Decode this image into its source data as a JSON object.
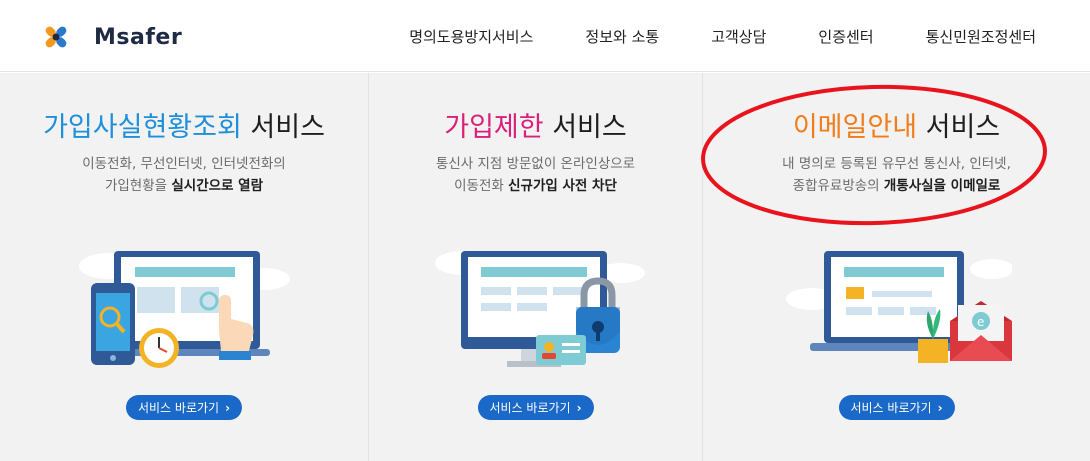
{
  "brand": {
    "name": "Msafer"
  },
  "nav": [
    {
      "label": "명의도용방지서비스"
    },
    {
      "label": "정보와 소통"
    },
    {
      "label": "고객상담"
    },
    {
      "label": "인증센터"
    },
    {
      "label": "통신민원조정센터"
    }
  ],
  "panels": [
    {
      "title_highlight": "가입사실현황조회",
      "title_rest": " 서비스",
      "highlight_color": "#1e8fd8",
      "desc_line1": "이동전화, 무선인터넷, 인터넷전화의",
      "desc_line2_plain": "가입현황을 ",
      "desc_line2_bold": "실시간으로 열람",
      "button": "서비스 바로가기",
      "illustration": "phone-monitor-clock-hand"
    },
    {
      "title_highlight": "가입제한",
      "title_rest": " 서비스",
      "highlight_color": "#d9207b",
      "desc_line1": "통신사 지점 방문없이 온라인상으로",
      "desc_line2_plain": "이동전화 ",
      "desc_line2_bold": "신규가입 사전 차단",
      "button": "서비스 바로가기",
      "illustration": "monitor-lock-idcard"
    },
    {
      "title_highlight": "이메일안내",
      "title_rest": " 서비스",
      "highlight_color": "#f07c1a",
      "desc_line1": "내 명의로 등록된 유무선 통신사, 인터넷,",
      "desc_line2_plain": "종합유료방송의 ",
      "desc_line2_bold": "개통사실을 이메일로",
      "button": "서비스 바로가기",
      "illustration": "laptop-plant-envelope"
    }
  ],
  "colors": {
    "button": "#1a68c7",
    "annotation": "#e8131c"
  }
}
